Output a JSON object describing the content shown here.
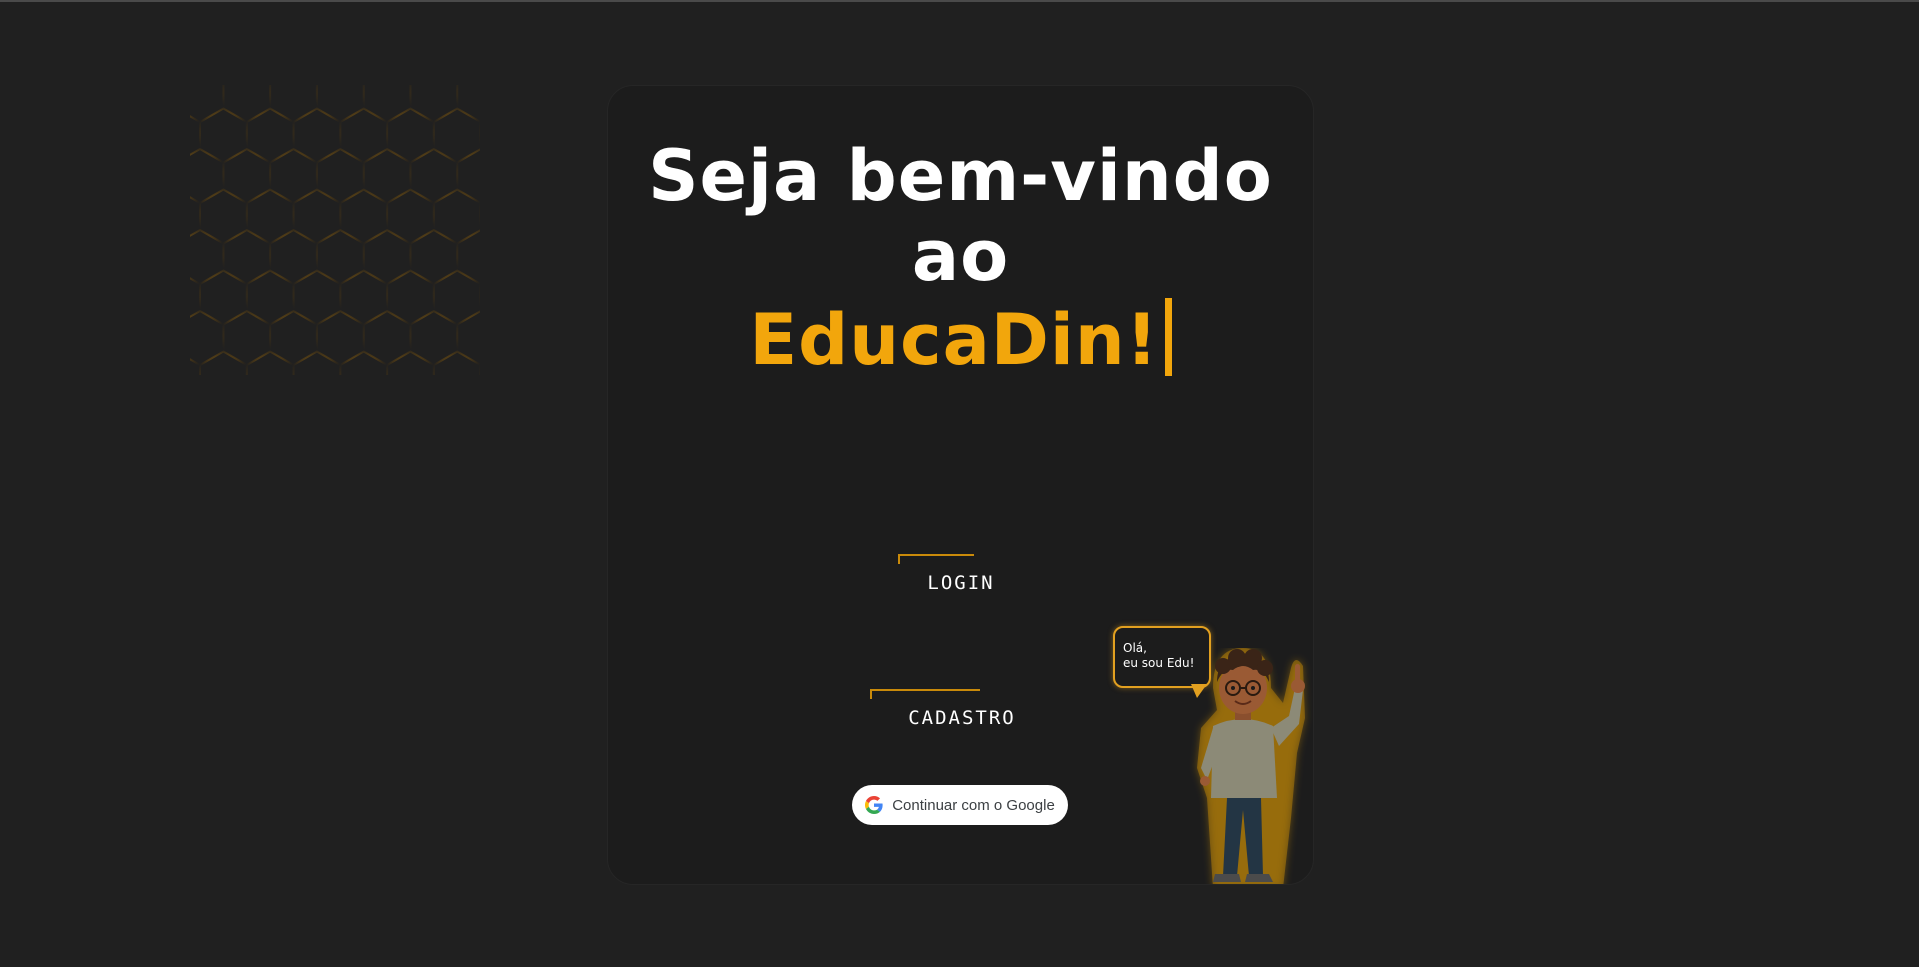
{
  "welcome": {
    "line1": "Seja bem-vindo",
    "line2": "ao",
    "brand": "EducaDin!"
  },
  "buttons": {
    "login": "LOGIN",
    "cadastro": "CADASTRO",
    "google": "Continuar com o Google"
  },
  "mascot": {
    "greeting_line1": "Olá,",
    "greeting_line2": "eu sou Edu!"
  },
  "colors": {
    "background": "#202020",
    "card": "#1c1c1c",
    "accent": "#f2a60c",
    "text": "#ffffff"
  },
  "icons": {
    "google": "google-g-icon",
    "honeycomb": "honeycomb-decoration",
    "caret": "text-caret"
  }
}
